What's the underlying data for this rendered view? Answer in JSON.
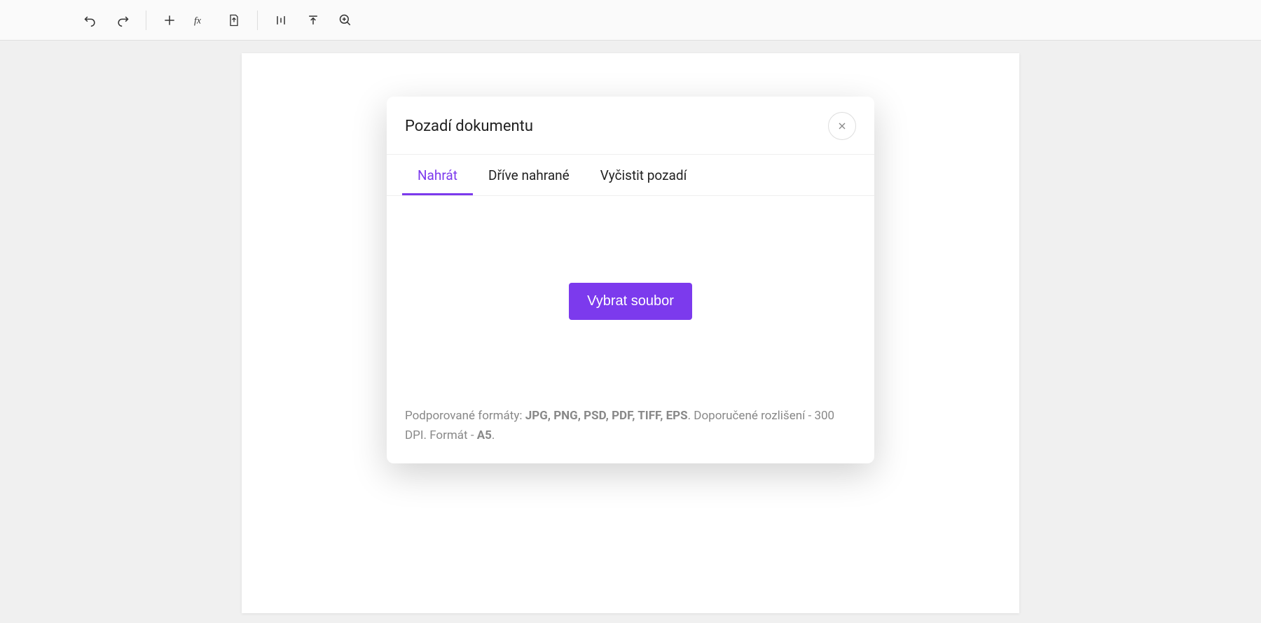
{
  "modal": {
    "title": "Pozadí dokumentu",
    "tabs": {
      "upload": "Nahrát",
      "previous": "Dříve nahrané",
      "clear": "Vyčistit pozadí"
    },
    "upload_button": "Vybrat soubor",
    "footer": {
      "supported_prefix": "Podporované formáty: ",
      "supported_formats": "JPG, PNG, PSD, PDF, TIFF, EPS",
      "resolution_part": ". Doporučené rozlišení - 300 DPI. Formát - ",
      "format_size": "A5",
      "suffix": "."
    }
  },
  "colors": {
    "accent": "#7c3aed"
  }
}
